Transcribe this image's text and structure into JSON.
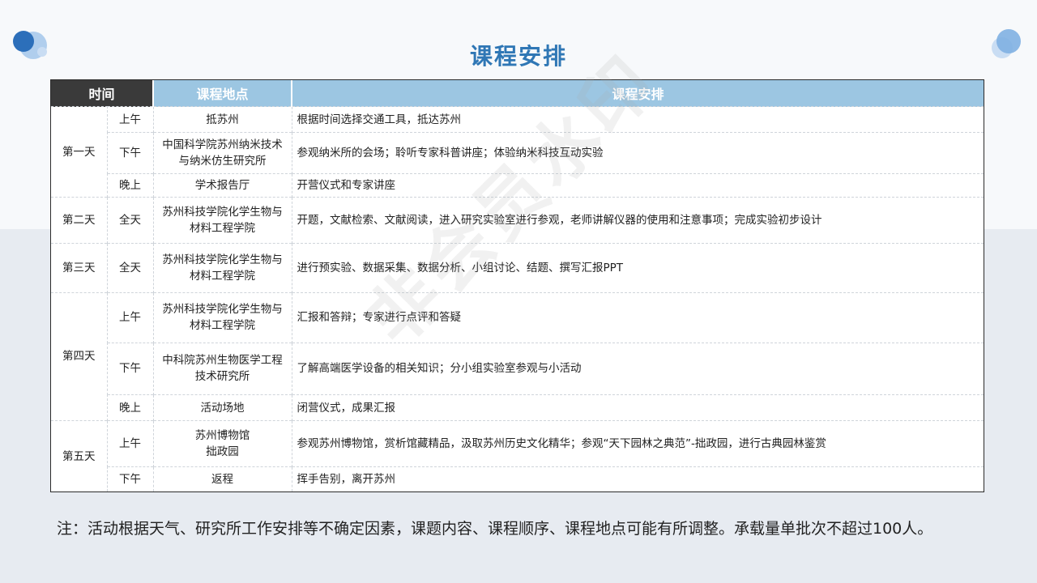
{
  "page": {
    "title": "课程安排"
  },
  "table": {
    "headers": {
      "time": "时间",
      "location": "课程地点",
      "program": "课程安排"
    },
    "days": [
      {
        "day": "第一天",
        "rows": [
          {
            "session": "上午",
            "location": "抵苏州",
            "program": "根据时间选择交通工具，抵达苏州"
          },
          {
            "session": "下午",
            "location": "中国科学院苏州纳米技术与纳米仿生研究所",
            "program": "参观纳米所的会场；聆听专家科普讲座；体验纳米科技互动实验"
          },
          {
            "session": "晚上",
            "location": "学术报告厅",
            "program": "开营仪式和专家讲座"
          }
        ]
      },
      {
        "day": "第二天",
        "rows": [
          {
            "session": "全天",
            "location": "苏州科技学院化学生物与材料工程学院",
            "program": "开题，文献检索、文献阅读，进入研究实验室进行参观，老师讲解仪器的使用和注意事项；完成实验初步设计"
          }
        ]
      },
      {
        "day": "第三天",
        "rows": [
          {
            "session": "全天",
            "location": "苏州科技学院化学生物与材料工程学院",
            "program": "进行预实验、数据采集、数据分析、小组讨论、结题、撰写汇报PPT"
          }
        ]
      },
      {
        "day": "第四天",
        "rows": [
          {
            "session": "上午",
            "location": "苏州科技学院化学生物与材料工程学院",
            "program": "汇报和答辩；专家进行点评和答疑"
          },
          {
            "session": "下午",
            "location": "中科院苏州生物医学工程技术研究所",
            "program": "了解高端医学设备的相关知识；分小组实验室参观与小活动"
          },
          {
            "session": "晚上",
            "location": "活动场地",
            "program": "闭营仪式，成果汇报"
          }
        ]
      },
      {
        "day": "第五天",
        "rows": [
          {
            "session": "上午",
            "location": "苏州博物馆\n拙政园",
            "program": "参观苏州博物馆，赏析馆藏精品，汲取苏州历史文化精华；参观“天下园林之典范”-拙政园，进行古典园林鉴赏"
          },
          {
            "session": "下午",
            "location": "返程",
            "program": "挥手告别，离开苏州"
          }
        ]
      }
    ]
  },
  "watermark": "非会员水印",
  "note": "注：活动根据天气、研究所工作安排等不确定因素，课题内容、课程顺序、课程地点可能有所调整。承载量单批次不超过100人。",
  "colors": {
    "title": "#2f77b5",
    "header_dark": "#3a3a3a",
    "header_blue": "#9cc6e2"
  }
}
